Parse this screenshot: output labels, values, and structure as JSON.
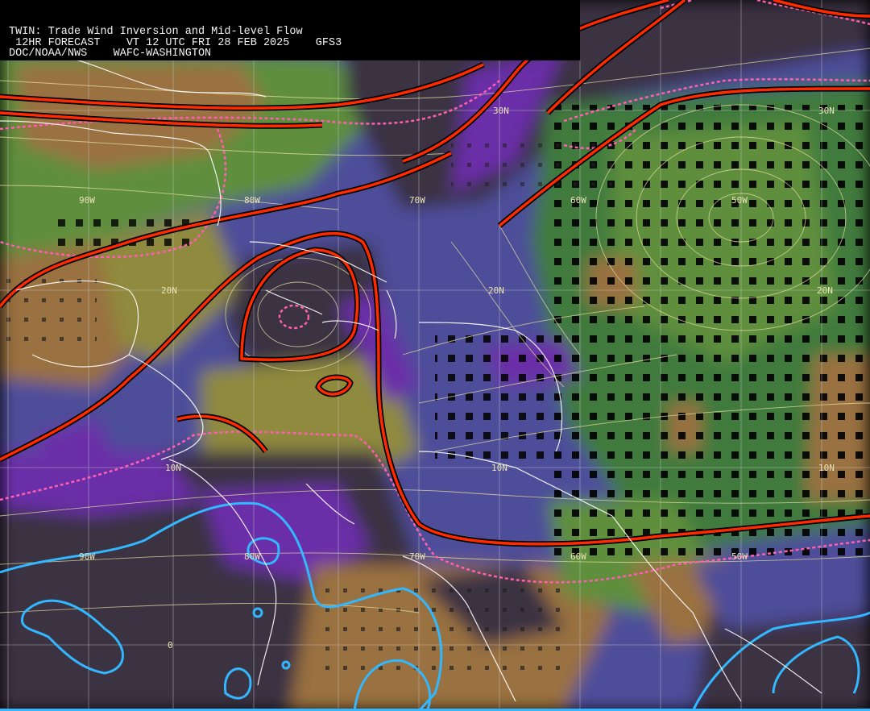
{
  "header": {
    "title": "TWIN: Trade Wind Inversion and Mid-level Flow",
    "forecast_line": " 12HR FORECAST    VT 12 UTC FRI 28 FEB 2025    GFS3",
    "agency_line": "DOC/NOAA/NWS    WAFC-WASHINGTON"
  },
  "grid_labels": {
    "lat": [
      "30N",
      "20N",
      "10N",
      "0"
    ],
    "lon": [
      "90W",
      "80W",
      "70W",
      "60W",
      "50W"
    ]
  },
  "colors": {
    "background_dark": "#3b3342",
    "purple": "#6a2fa8",
    "blue": "#4d4e9a",
    "green_dark": "#3f7a3c",
    "green": "#5f8f3c",
    "olive": "#8f8a3c",
    "brown": "#9a7140",
    "trough_red": "#ff2a00",
    "dashed_magenta": "#ff5fb0",
    "cyan": "#33b7ff",
    "streamline": "#e8e0a0",
    "coast": "#ffffff"
  }
}
